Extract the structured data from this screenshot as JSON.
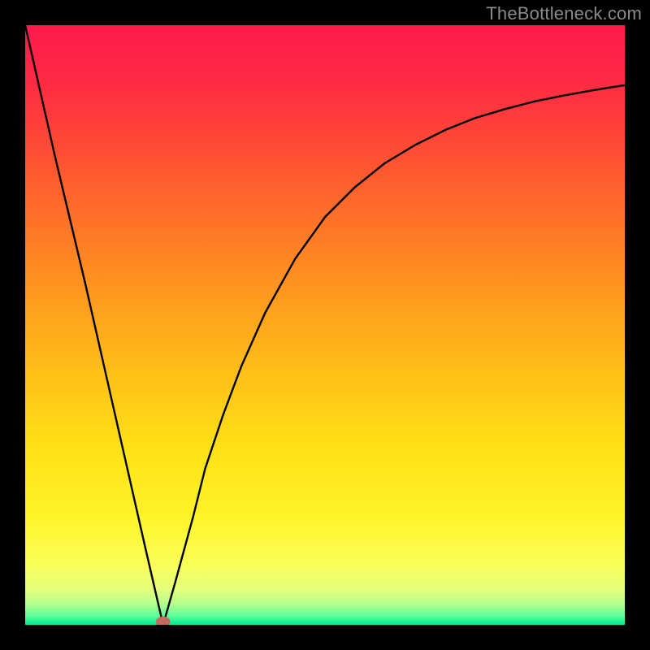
{
  "watermark": "TheBottleneck.com",
  "chart_data": {
    "type": "line",
    "title": "",
    "xlabel": "",
    "ylabel": "",
    "xlim": [
      0,
      100
    ],
    "ylim": [
      0,
      100
    ],
    "series": [
      {
        "name": "bottleneck-curve",
        "x": [
          0,
          5,
          10,
          15,
          20,
          23,
          25,
          28,
          30,
          33,
          36,
          40,
          45,
          50,
          55,
          60,
          65,
          70,
          75,
          80,
          85,
          90,
          95,
          100
        ],
        "y": [
          100,
          78,
          57,
          35,
          13,
          0,
          7,
          18,
          26,
          35,
          43,
          52,
          61,
          68,
          73,
          77,
          80,
          82.5,
          84.5,
          86,
          87.3,
          88.3,
          89.2,
          90
        ]
      }
    ],
    "marker": {
      "x": 23,
      "y": 0,
      "color": "#c36a5d"
    },
    "gradient_stops": [
      {
        "offset": 0.0,
        "color": "#ff1a4d"
      },
      {
        "offset": 0.1,
        "color": "#ff2b42"
      },
      {
        "offset": 0.25,
        "color": "#ff5a2f"
      },
      {
        "offset": 0.4,
        "color": "#ff8a22"
      },
      {
        "offset": 0.55,
        "color": "#ffb719"
      },
      {
        "offset": 0.7,
        "color": "#ffe016"
      },
      {
        "offset": 0.82,
        "color": "#fff429"
      },
      {
        "offset": 0.9,
        "color": "#faff59"
      },
      {
        "offset": 0.94,
        "color": "#e4ff7a"
      },
      {
        "offset": 0.965,
        "color": "#b6ff8e"
      },
      {
        "offset": 0.985,
        "color": "#5dff99"
      },
      {
        "offset": 1.0,
        "color": "#00e890"
      }
    ]
  }
}
